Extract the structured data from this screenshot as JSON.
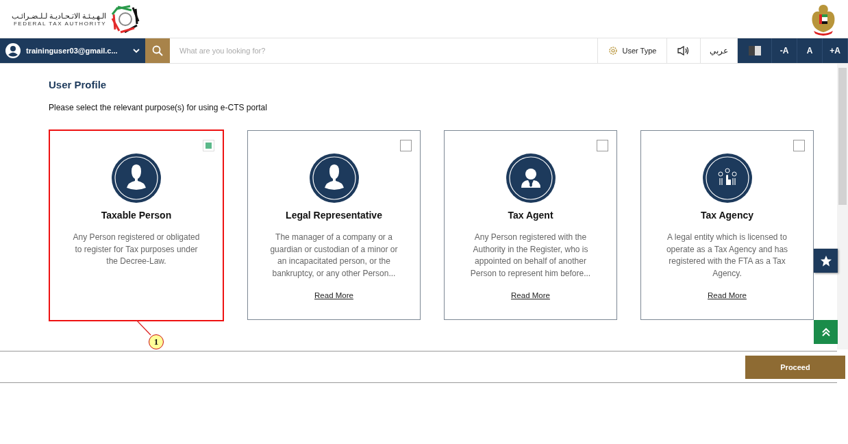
{
  "header": {
    "logo_arabic": "الـهـيـئـة الاتـحـاديـة لـلـضـرائـب",
    "logo_english": "FEDERAL TAX AUTHORITY"
  },
  "navbar": {
    "user_email": "traininguser03@gmail.c...",
    "search": {
      "placeholder": "What are you looking for?"
    },
    "user_type": "User Type",
    "language": "عربي",
    "font_buttons": [
      "-A",
      "A",
      "+A"
    ]
  },
  "page": {
    "title": "User Profile",
    "instruction": "Please select the relevant purpose(s) for using e-CTS portal"
  },
  "cards": [
    {
      "kind": "person",
      "title": "Taxable Person",
      "description": "Any Person registered or obligated to register for Tax purposes under the Decree-Law.",
      "checked": true,
      "highlighted": true
    },
    {
      "kind": "person",
      "title": "Legal Representative",
      "description": "The manager of a company or a guardian or custodian of a minor or an incapacitated person, or the bankruptcy, or any other Person...",
      "read_more": "Read More",
      "checked": false,
      "highlighted": false
    },
    {
      "kind": "agent",
      "title": "Tax Agent",
      "description": "Any Person registered with the Authority in the Register, who is appointed on behalf of another Person to represent him before...",
      "read_more": "Read More",
      "checked": false,
      "highlighted": false
    },
    {
      "kind": "agency",
      "title": "Tax Agency",
      "description": "A legal entity which is licensed to operate as a Tax Agency and has registered with the FTA as a Tax Agency.",
      "read_more": "Read More",
      "checked": false,
      "highlighted": false
    }
  ],
  "callout": {
    "label": "1"
  },
  "footer": {
    "proceed": "Proceed"
  }
}
